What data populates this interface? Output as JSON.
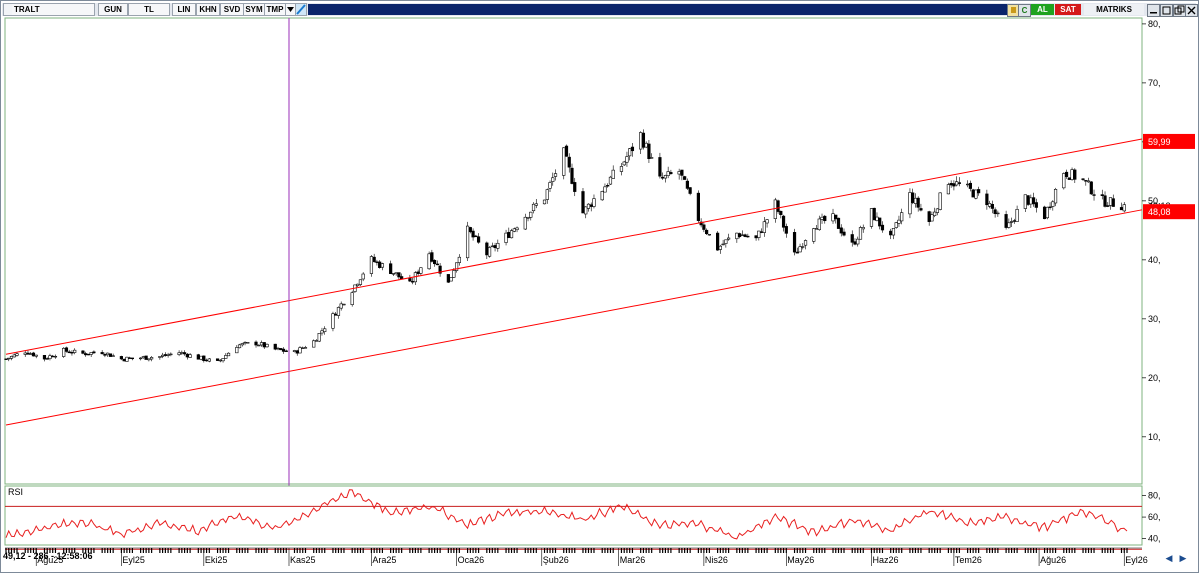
{
  "toolbar": {
    "symbol": "TRALT",
    "period": "GUN",
    "currency": "TL",
    "scale": "LIN",
    "buttons": [
      "KHN",
      "SVD",
      "SYM",
      "TMP"
    ],
    "buy_label": "AL",
    "sell_label": "SAT",
    "brand": "MATRIKS",
    "logo_letter": "M",
    "refresh_label": "C"
  },
  "status": {
    "text": "49,12 - 286 - 12:58:06"
  },
  "colors": {
    "channel_line": "#ff0000",
    "cursor_line": "#9b30b8",
    "rsi_line": "#e82020",
    "rsi_band": "#c81e1e",
    "price_label_bg": "#ff0000",
    "buy": "#1fa31f",
    "sell": "#d41a1a"
  },
  "icons": [
    "logo-m-icon",
    "dropdown-arrow-icon",
    "chart-pen-icon",
    "refresh-icon",
    "scroll-left-icon",
    "scroll-right-icon"
  ],
  "chart_data": [
    {
      "type": "candlestick",
      "title": "",
      "symbol": "TRALT",
      "x_axis": {
        "type": "date",
        "tick_labels": [
          "Ağu25",
          "Eyl25",
          "Eki25",
          "Kas25",
          "Ara25",
          "Oca26",
          "Şub26",
          "Mar26",
          "Nis26",
          "May26",
          "Haz26",
          "Tem26",
          "Ağu26",
          "Eyl26"
        ],
        "range": [
          "2025-07-21",
          "2026-09-02"
        ]
      },
      "y_axis": {
        "position": "right",
        "ticks": [
          10,
          20,
          30,
          40,
          50,
          60,
          70,
          80
        ],
        "tick_labels": [
          "10,",
          "20,",
          "30,",
          "40,",
          "50,",
          "60,",
          "70,",
          "80,"
        ],
        "ylim": [
          2,
          81
        ]
      },
      "grid": false,
      "price_labels": [
        "59,99",
        "49,12",
        "48,08"
      ],
      "last_price": 49.12,
      "series": [
        {
          "type": "price_path",
          "points": [
            [
              "2025-07-21",
              23.2
            ],
            [
              "2025-07-28",
              24.5
            ],
            [
              "2025-08-04",
              23.3
            ],
            [
              "2025-08-11",
              24.6
            ],
            [
              "2025-08-18",
              24.1
            ],
            [
              "2025-08-25",
              24.4
            ],
            [
              "2025-09-01",
              23.2
            ],
            [
              "2025-09-08",
              23.4
            ],
            [
              "2025-09-15",
              23.6
            ],
            [
              "2025-09-22",
              24.3
            ],
            [
              "2025-09-29",
              23.4
            ],
            [
              "2025-10-06",
              22.6
            ],
            [
              "2025-10-13",
              25.5
            ],
            [
              "2025-10-20",
              25.9
            ],
            [
              "2025-10-27",
              24.8
            ],
            [
              "2025-11-03",
              24.3
            ],
            [
              "2025-11-10",
              26.2
            ],
            [
              "2025-11-17",
              30.5
            ],
            [
              "2025-11-24",
              35.0
            ],
            [
              "2025-12-01",
              40.0
            ],
            [
              "2025-12-08",
              38.2
            ],
            [
              "2025-12-15",
              35.8
            ],
            [
              "2025-12-22",
              41.2
            ],
            [
              "2025-12-29",
              36.0
            ],
            [
              "2026-01-05",
              45.0
            ],
            [
              "2026-01-12",
              41.0
            ],
            [
              "2026-01-19",
              44.0
            ],
            [
              "2026-01-26",
              47.5
            ],
            [
              "2026-02-02",
              50.6
            ],
            [
              "2026-02-09",
              58.0
            ],
            [
              "2026-02-16",
              48.0
            ],
            [
              "2026-02-23",
              52.0
            ],
            [
              "2026-03-02",
              56.0
            ],
            [
              "2026-03-09",
              61.2
            ],
            [
              "2026-03-16",
              53.5
            ],
            [
              "2026-03-23",
              55.0
            ],
            [
              "2026-03-30",
              47.0
            ],
            [
              "2026-04-06",
              42.0
            ],
            [
              "2026-04-13",
              44.5
            ],
            [
              "2026-04-20",
              43.5
            ],
            [
              "2026-04-27",
              49.5
            ],
            [
              "2026-05-04",
              40.8
            ],
            [
              "2026-05-11",
              46.0
            ],
            [
              "2026-05-18",
              47.0
            ],
            [
              "2026-05-25",
              42.5
            ],
            [
              "2026-06-01",
              48.0
            ],
            [
              "2026-06-08",
              43.5
            ],
            [
              "2026-06-15",
              51.0
            ],
            [
              "2026-06-22",
              46.5
            ],
            [
              "2026-06-29",
              53.5
            ],
            [
              "2026-07-06",
              52.0
            ],
            [
              "2026-07-13",
              50.0
            ],
            [
              "2026-07-20",
              45.0
            ],
            [
              "2026-07-27",
              50.5
            ],
            [
              "2026-08-03",
              47.5
            ],
            [
              "2026-08-10",
              55.0
            ],
            [
              "2026-08-17",
              53.5
            ],
            [
              "2026-08-24",
              50.0
            ],
            [
              "2026-09-02",
              49.12
            ]
          ]
        },
        {
          "type": "trendline",
          "points": [
            [
              "2025-07-21",
              24.0
            ],
            [
              "2026-09-02",
              60.0
            ]
          ]
        },
        {
          "type": "trendline",
          "points": [
            [
              "2025-07-21",
              12.0
            ],
            [
              "2026-09-02",
              48.0
            ]
          ]
        }
      ],
      "annotations": [
        {
          "type": "vertical_line",
          "x": "2025-11-01"
        }
      ]
    },
    {
      "type": "line",
      "title": "RSI",
      "y_axis": {
        "position": "right",
        "ticks": [
          40,
          60,
          80
        ],
        "tick_labels": [
          "40,",
          "60,",
          "80,"
        ],
        "ylim": [
          34,
          88
        ]
      },
      "bands": [
        30,
        70
      ],
      "series": [
        {
          "name": "RSI",
          "x": [
            "2025-07-21",
            "2025-08-04",
            "2025-08-18",
            "2025-09-01",
            "2025-09-15",
            "2025-09-29",
            "2025-10-13",
            "2025-10-27",
            "2025-11-10",
            "2025-11-24",
            "2025-12-08",
            "2025-12-22",
            "2026-01-05",
            "2026-01-19",
            "2026-02-02",
            "2026-02-16",
            "2026-03-02",
            "2026-03-16",
            "2026-03-30",
            "2026-04-13",
            "2026-04-27",
            "2026-05-11",
            "2026-05-25",
            "2026-06-08",
            "2026-06-22",
            "2026-07-06",
            "2026-07-20",
            "2026-08-03",
            "2026-08-17",
            "2026-09-02"
          ],
          "values": [
            42,
            50,
            56,
            44,
            55,
            47,
            62,
            49,
            66,
            84,
            63,
            71,
            53,
            64,
            66,
            58,
            70,
            52,
            54,
            41,
            60,
            46,
            57,
            48,
            66,
            54,
            60,
            50,
            66,
            47
          ]
        }
      ]
    }
  ]
}
